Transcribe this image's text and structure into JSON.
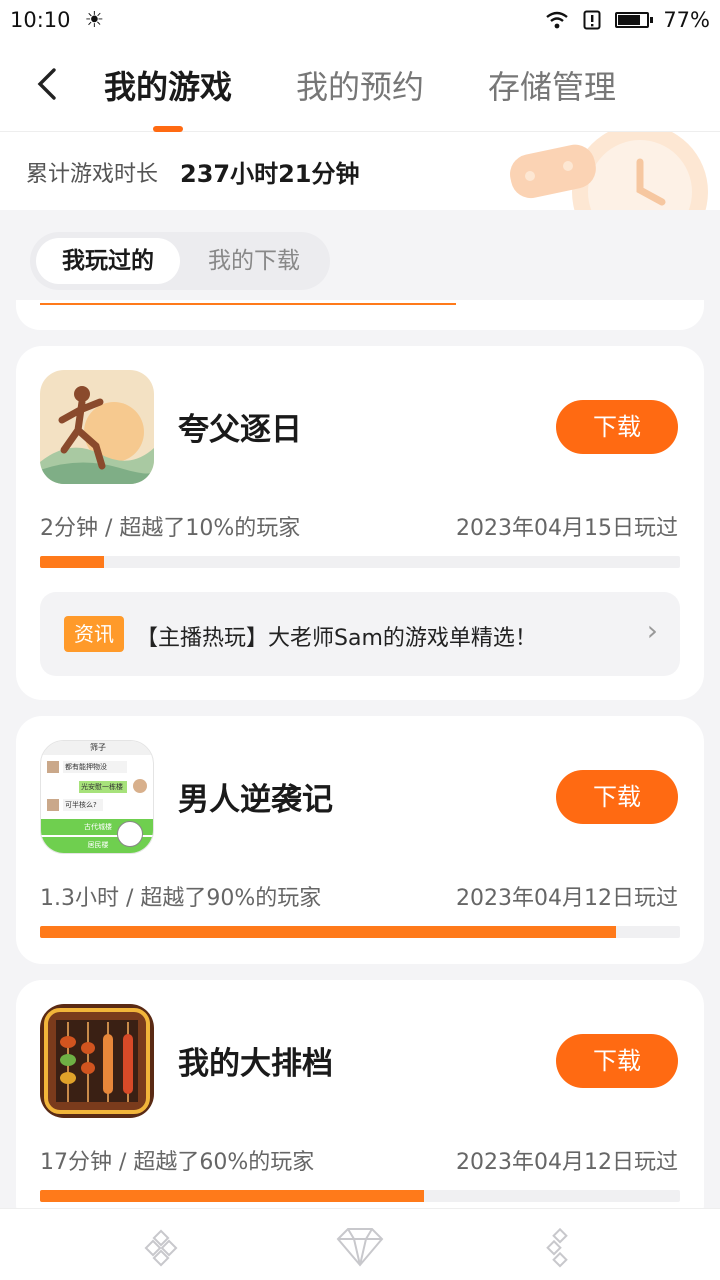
{
  "status_bar": {
    "time": "10:10",
    "battery": "77%",
    "battery_level": 0.77
  },
  "nav": {
    "tabs": [
      "我的游戏",
      "我的预约",
      "存储管理"
    ],
    "active_tab": 0
  },
  "playtime": {
    "label": "累计游戏时长",
    "value": "237小时21分钟"
  },
  "segment": {
    "options": [
      "我玩过的",
      "我的下载"
    ],
    "selected": 0
  },
  "games": [
    {
      "name": "夸父逐日",
      "button": "下载",
      "stat": "2分钟 / 超越了10%的玩家",
      "date": "2023年04月15日玩过",
      "progress": 0.1,
      "news": {
        "badge": "资讯",
        "text": "【主播热玩】大老师Sam的游戏单精选！"
      }
    },
    {
      "name": "男人逆袭记",
      "button": "下载",
      "stat": "1.3小时 / 超越了90%的玩家",
      "date": "2023年04月12日玩过",
      "progress": 0.9
    },
    {
      "name": "我的大排档",
      "button": "下载",
      "stat": "17分钟 / 超越了60%的玩家",
      "date": "2023年04月12日玩过",
      "progress": 0.6
    }
  ],
  "game_icon_texts": {
    "game2": {
      "title": "筛子",
      "bubble1": "都有能押物没",
      "bubble2": "光安慰一栋楼",
      "bubble3": "可半核么?",
      "option1": "古代城楼",
      "option2": "居民楼"
    }
  },
  "colors": {
    "accent": "#ff6a12",
    "progress": "#ff7a1a",
    "badge": "#ff9a2a"
  }
}
